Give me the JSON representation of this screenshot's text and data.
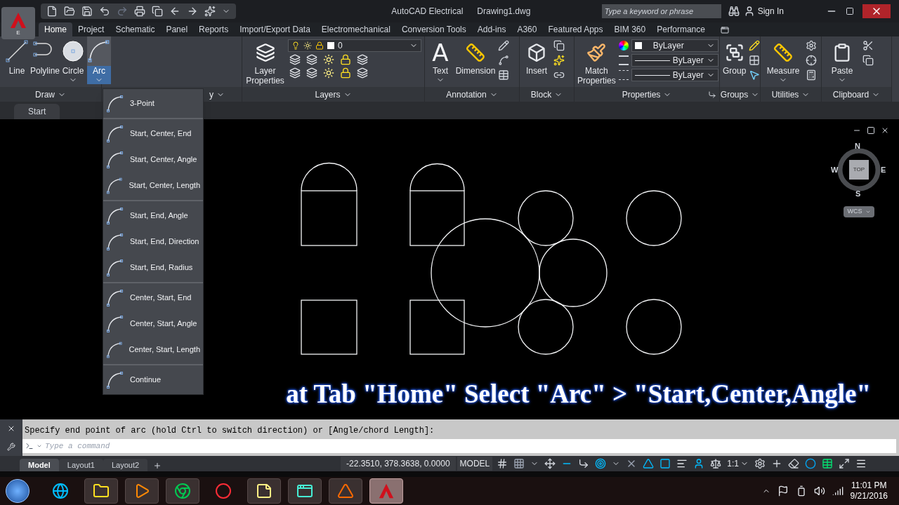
{
  "title_bar": {
    "app_badge": "E",
    "title": "AutoCAD Electrical",
    "document": "Drawing1.dwg",
    "search": {
      "placeholder": "Type a keyword or phrase"
    },
    "sign_in": "Sign In"
  },
  "tabs": [
    {
      "label": "Home",
      "selected": true
    },
    {
      "label": "Project",
      "selected": false
    },
    {
      "label": "Schematic",
      "selected": false
    },
    {
      "label": "Panel",
      "selected": false
    },
    {
      "label": "Reports",
      "selected": false
    },
    {
      "label": "Import/Export Data",
      "selected": false
    },
    {
      "label": "Electromechanical",
      "selected": false
    },
    {
      "label": "Conversion Tools",
      "selected": false
    },
    {
      "label": "Add-ins",
      "selected": false
    },
    {
      "label": "A360",
      "selected": false
    },
    {
      "label": "Featured Apps",
      "selected": false
    },
    {
      "label": "BIM 360",
      "selected": false
    },
    {
      "label": "Performance",
      "selected": false
    }
  ],
  "ribbon": {
    "draw": {
      "title": "Draw",
      "tools": [
        {
          "label": "Line",
          "kind": "line",
          "pressed": false
        },
        {
          "label": "Polyline",
          "kind": "polyline",
          "pressed": false
        },
        {
          "label": "Circle",
          "kind": "circle",
          "pressed": false
        },
        {
          "label": "Arc",
          "kind": "arc",
          "pressed": true
        }
      ]
    },
    "modify": {
      "title": "y"
    },
    "layers": {
      "title": "Layers",
      "tool": "Layer Properties",
      "current_layer": "0"
    },
    "annotation": {
      "title": "Annotation",
      "text_icon": "A",
      "tools": [
        "Text",
        "Dimension"
      ]
    },
    "block": {
      "title": "Block",
      "tool": "Insert"
    },
    "properties": {
      "title": "Properties",
      "tool": "Match Properties",
      "combos": [
        {
          "value": "ByLayer",
          "kind": "color"
        },
        {
          "value": "ByLayer",
          "kind": "linetype"
        },
        {
          "value": "ByLayer",
          "kind": "lineweight"
        }
      ]
    },
    "groups": {
      "title": "Groups",
      "tool": "Group"
    },
    "utilities": {
      "title": "Utilities",
      "tool": "Measure"
    },
    "clipboard": {
      "title": "Clipboard",
      "tool": "Paste"
    }
  },
  "file_tab": "Start",
  "arc_menu": {
    "groups": [
      [
        "3-Point"
      ],
      [
        "Start, Center, End",
        "Start, Center, Angle",
        "Start, Center, Length"
      ],
      [
        "Start, End, Angle",
        "Start, End, Direction",
        "Start, End, Radius"
      ],
      [
        "Center, Start, End",
        "Center, Start, Angle",
        "Center, Start, Length"
      ],
      [
        "Continue"
      ]
    ]
  },
  "viewcube": {
    "north": "N",
    "south": "S",
    "east": "E",
    "west": "W",
    "face": "TOP",
    "ucs": "WCS"
  },
  "caption": "at Tab \"Home\" Select \"Arc\" > \"Start,Center,Angle\"",
  "command_line": {
    "prompt": "Specify end point of arc (hold Ctrl to switch direction) or [Angle/chord Length]:",
    "placeholder": "Type a command"
  },
  "layout_tabs": [
    {
      "label": "Model",
      "selected": true
    },
    {
      "label": "Layout1",
      "selected": false
    },
    {
      "label": "Layout2",
      "selected": false
    }
  ],
  "status_bar": {
    "coordinates": "-22.3510, 378.3638, 0.0000",
    "space": "MODEL",
    "scale": "1:1"
  },
  "taskbar": {
    "time": "11:01 PM",
    "date": "9/21/2016"
  }
}
